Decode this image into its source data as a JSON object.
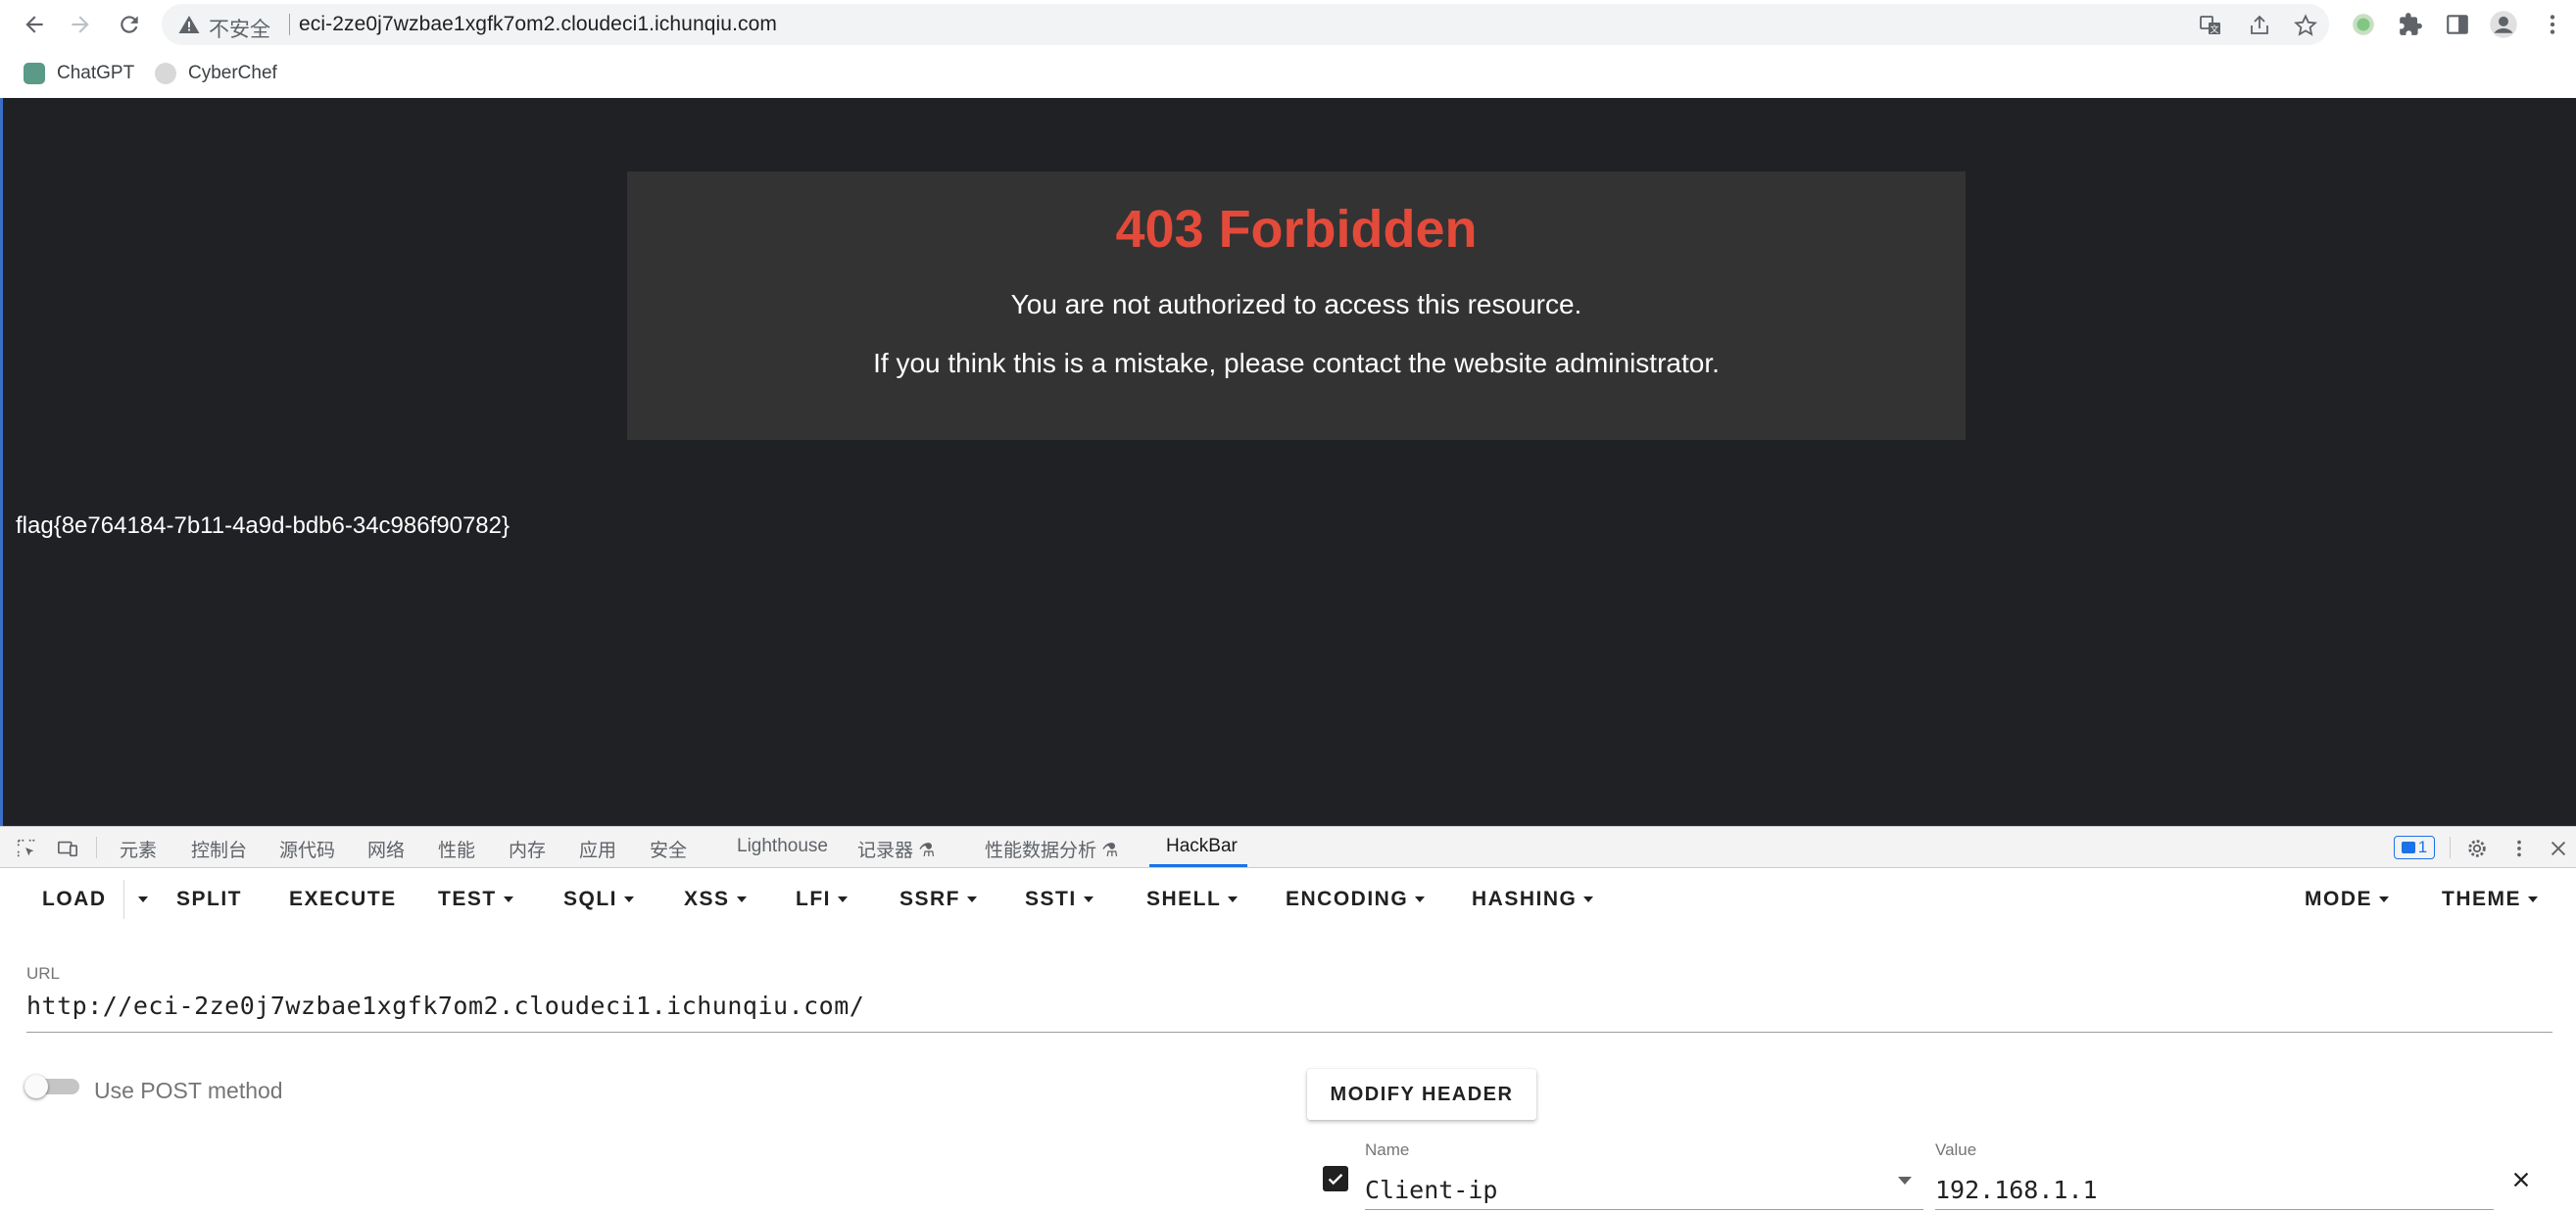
{
  "browser": {
    "omnibox": {
      "security_label": "不安全",
      "url": "eci-2ze0j7wzbae1xgfk7om2.cloudeci1.ichunqiu.com"
    },
    "bookmarks": [
      {
        "label": "ChatGPT",
        "icon": "chatgpt-icon"
      },
      {
        "label": "CyberChef",
        "icon": "cyberchef-icon"
      }
    ]
  },
  "page": {
    "error_title": "403 Forbidden",
    "error_message": "You are not authorized to access this resource.",
    "error_hint": "If you think this is a mistake, please contact the website administrator.",
    "flag": "flag{8e764184-7b11-4a9d-bdb6-34c986f90782}"
  },
  "devtools": {
    "tabs": [
      "元素",
      "控制台",
      "源代码",
      "网络",
      "性能",
      "内存",
      "应用",
      "安全",
      "Lighthouse",
      "记录器",
      "性能数据分析",
      "HackBar"
    ],
    "active_tab": "HackBar",
    "issues_count": "1"
  },
  "hackbar": {
    "menu": {
      "load": "LOAD",
      "split": "SPLIT",
      "execute": "EXECUTE",
      "test": "TEST",
      "sqli": "SQLI",
      "xss": "XSS",
      "lfi": "LFI",
      "ssrf": "SSRF",
      "ssti": "SSTI",
      "shell": "SHELL",
      "encoding": "ENCODING",
      "hashing": "HASHING",
      "mode": "MODE",
      "theme": "THEME"
    },
    "url_label": "URL",
    "url_value": "http://eci-2ze0j7wzbae1xgfk7om2.cloudeci1.ichunqiu.com/",
    "post_label": "Use POST method",
    "post_enabled": false,
    "modify_header_label": "MODIFY HEADER",
    "header": {
      "enabled": true,
      "name_label": "Name",
      "name": "Client-ip",
      "value_label": "Value",
      "value": "192.168.1.1"
    }
  }
}
